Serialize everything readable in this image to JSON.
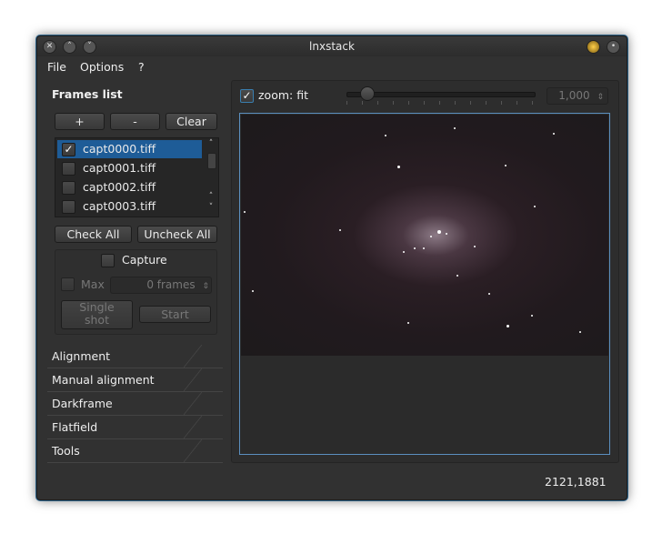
{
  "window": {
    "title": "lnxstack"
  },
  "menu": [
    "File",
    "Options",
    "?"
  ],
  "frames_list": {
    "title": "Frames list",
    "add_label": "+",
    "remove_label": "-",
    "clear_label": "Clear",
    "items": [
      {
        "label": "capt0000.tiff",
        "checked": "✓"
      },
      {
        "label": "capt0001.tiff",
        "checked": ""
      },
      {
        "label": "capt0002.tiff",
        "checked": ""
      },
      {
        "label": "capt0003.tiff",
        "checked": ""
      }
    ],
    "check_all_label": "Check All",
    "uncheck_all_label": "Uncheck All"
  },
  "capture": {
    "label": "Capture",
    "max_label": "Max",
    "frames_value": "0 frames",
    "single_shot_label_1": "Single",
    "single_shot_label_2": "shot",
    "start_label": "Start"
  },
  "sections": [
    "Alignment",
    "Manual alignment",
    "Darkframe",
    "Flatfield",
    "Tools"
  ],
  "viewer": {
    "zoom_label": "zoom: fit",
    "zoom_checked": "✓",
    "zoom_value": "1,000",
    "zoom_slider_fraction": 0.07
  },
  "status": {
    "coords": "2121,1881"
  },
  "colors": {
    "selection": "#1e5c97",
    "accent_border": "#5b8fbf",
    "window_bg": "#313131"
  }
}
